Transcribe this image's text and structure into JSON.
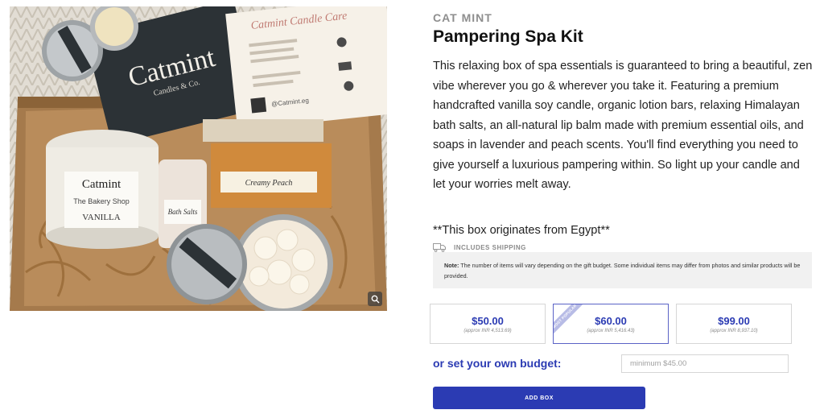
{
  "product": {
    "brand": "CAT MINT",
    "title": "Pampering Spa Kit",
    "description": "This relaxing box of spa essentials is guaranteed to bring a beautiful, zen vibe wherever you go & wherever you take it. Featuring a premium handcrafted vanilla soy candle, organic lotion bars, relaxing Himalayan bath salts, an all-natural lip balm made with premium essential oils, and soaps in lavender and peach scents. You'll find everything you need to give yourself a luxurious pampering within. So light up your candle and let your worries melt away.",
    "origin": "**This box originates from Egypt**",
    "shipping": {
      "icon": "truck-icon",
      "label": "INCLUDES SHIPPING"
    }
  },
  "photo": {
    "card_brand": "Catmint",
    "card_sub": "Candles & Co.",
    "care_card_title": "Catmint Candle Care",
    "candle_label_1": "Catmint",
    "candle_label_2": "The Bakery Shop",
    "candle_label_3": "VANILLA",
    "salts_label": "Bath Salts",
    "soap_label": "Creamy Peach",
    "instagram": "@Catmint.eg",
    "zoom_icon": "magnifier-icon"
  },
  "note": {
    "prefix": "Note:",
    "text": " The number of items will vary depending on the gift budget. Some individual items may differ from photos and similar products will be provided."
  },
  "tiers": [
    {
      "price": "$50.00",
      "approx": "(approx INR 4,513.69)",
      "selected": false
    },
    {
      "price": "$60.00",
      "approx": "(approx INR 5,416.43)",
      "selected": true,
      "ribbon": "MOST POPULAR"
    },
    {
      "price": "$99.00",
      "approx": "(approx INR 8,937.10)",
      "selected": false
    }
  ],
  "own_budget": {
    "label": "or set your own budget:",
    "placeholder": "minimum $45.00",
    "value": ""
  },
  "add_button": "ADD BOX",
  "colors": {
    "accent": "#2b3bb3",
    "note_bg": "#f1f1f1",
    "brand_gray": "#8e8e8e"
  }
}
